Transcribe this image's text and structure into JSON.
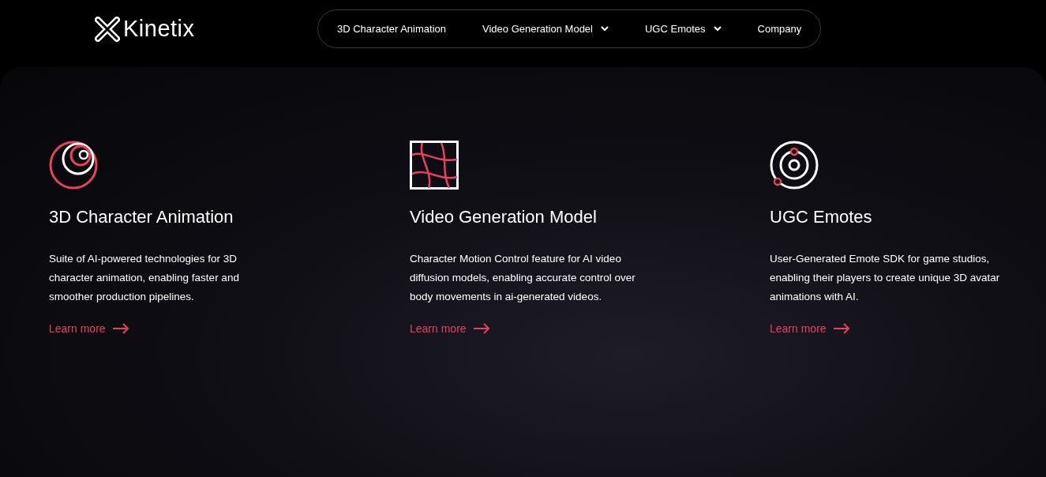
{
  "logo": {
    "text": "Kinetix"
  },
  "nav": [
    {
      "label": "3D Character Animation",
      "kind": "link"
    },
    {
      "label": "Video Generation Model",
      "kind": "dropdown"
    },
    {
      "label": "UGC Emotes",
      "kind": "dropdown"
    },
    {
      "label": "Company",
      "kind": "link"
    }
  ],
  "cards": [
    {
      "kind": "rings",
      "title": "3D Character Animation",
      "text": "Suite of AI-powered technologies for 3D character animation, enabling faster and smoother production pipelines.",
      "link": "Learn more"
    },
    {
      "kind": "grid",
      "title": "Video Generation Model",
      "text": "Character Motion Control feature for AI video diffusion models, enabling accurate control over body movements in ai-generated videos.",
      "link": "Learn more"
    },
    {
      "kind": "orbit",
      "title": "UGC Emotes",
      "text": "User-Generated Emote SDK for game studios, enabling their players to create unique 3D avatar animations with AI.",
      "link": "Learn more"
    }
  ]
}
